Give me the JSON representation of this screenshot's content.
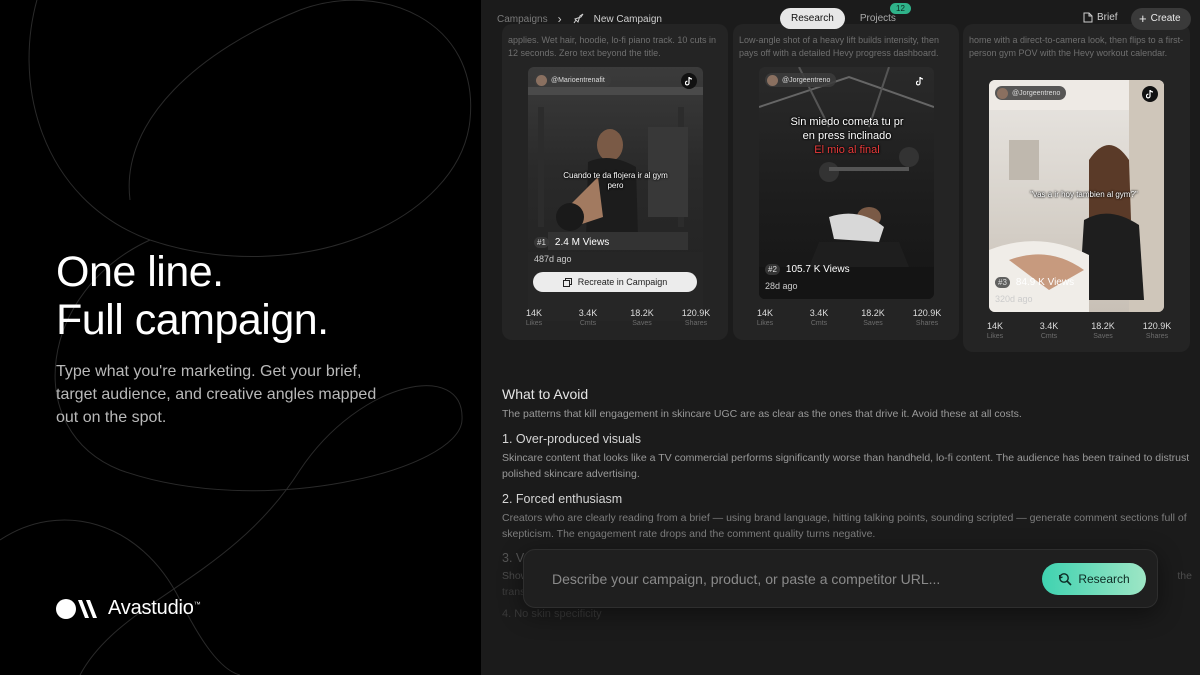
{
  "hero": {
    "title_line1": "One line.",
    "title_line2": "Full campaign.",
    "subtitle": "Type what you're marketing. Get your brief, target audience, and creative angles mapped out on the spot."
  },
  "brand": {
    "name": "Avastudio",
    "trademark": "™"
  },
  "topbar": {
    "breadcrumb_root": "Campaigns",
    "breadcrumb_current": "New Campaign",
    "tab_research": "Research",
    "tab_projects": "Projects",
    "projects_count": "12",
    "brief_label": "Brief",
    "create_label": "Create"
  },
  "cards": [
    {
      "desc": "applies. Wet hair, hoodie, lo-fi piano track. 10 cuts in 12 seconds. Zero text beyond the title.",
      "handle": "@Marioentrenafit",
      "overlay": "Cuando te da flojera ir al gym pero",
      "rank": "#1",
      "views": "2.4 M Views",
      "age": "487d ago",
      "recreate": "Recreate in Campaign",
      "stats": [
        {
          "num": "14K",
          "lbl": "Likes"
        },
        {
          "num": "3.4K",
          "lbl": "Cmts"
        },
        {
          "num": "18.2K",
          "lbl": "Saves"
        },
        {
          "num": "120.9K",
          "lbl": "Shares"
        }
      ]
    },
    {
      "desc": "Low-angle shot of a heavy lift builds intensity, then pays off with a detailed Hevy progress dashboard.",
      "handle": "@Jorgeentreno",
      "overlay1": "Sin miedo cometa tu pr",
      "overlay2": "en press inclinado",
      "overlay3": "El mio al final",
      "rank": "#2",
      "views": "105.7 K Views",
      "age": "28d ago",
      "stats": [
        {
          "num": "14K",
          "lbl": "Likes"
        },
        {
          "num": "3.4K",
          "lbl": "Cmts"
        },
        {
          "num": "18.2K",
          "lbl": "Saves"
        },
        {
          "num": "120.9K",
          "lbl": "Shares"
        }
      ]
    },
    {
      "desc": "home with a direct-to-camera look, then flips to a first-person gym POV with the Hevy workout calendar.",
      "handle": "@Jorgeentreno",
      "overlay": "\"vas a ir hoy tambien al gym?\"",
      "rank": "#3",
      "views": "84.9 K Views",
      "age": "320d ago",
      "stats": [
        {
          "num": "14K",
          "lbl": "Likes"
        },
        {
          "num": "3.4K",
          "lbl": "Cmts"
        },
        {
          "num": "18.2K",
          "lbl": "Saves"
        },
        {
          "num": "120.9K",
          "lbl": "Shares"
        }
      ]
    }
  ],
  "article": {
    "heading": "What to Avoid",
    "intro": "The patterns that kill engagement in skincare UGC are as clear as the ones that drive it. Avoid these at all costs.",
    "items": [
      {
        "title": "1. Over-produced visuals",
        "body": "Skincare content that looks like a TV commercial performs significantly worse than handheld, lo-fi content. The audience has been trained to distrust polished skincare advertising."
      },
      {
        "title": "2. Forced enthusiasm",
        "body": "Creators who are clearly reading from a brief — using brand language, hitting talking points, sounding scripted — generate comment sections full of skepticism. The engagement rate drops and the comment quality turns negative."
      },
      {
        "title": "3. Va",
        "body_start": "Show",
        "body_end": "the",
        "body_line2": "trans"
      },
      {
        "title": "4. No skin specificity"
      }
    ]
  },
  "prompt": {
    "placeholder": "Describe your campaign, product, or paste a competitor URL...",
    "button": "Research"
  }
}
